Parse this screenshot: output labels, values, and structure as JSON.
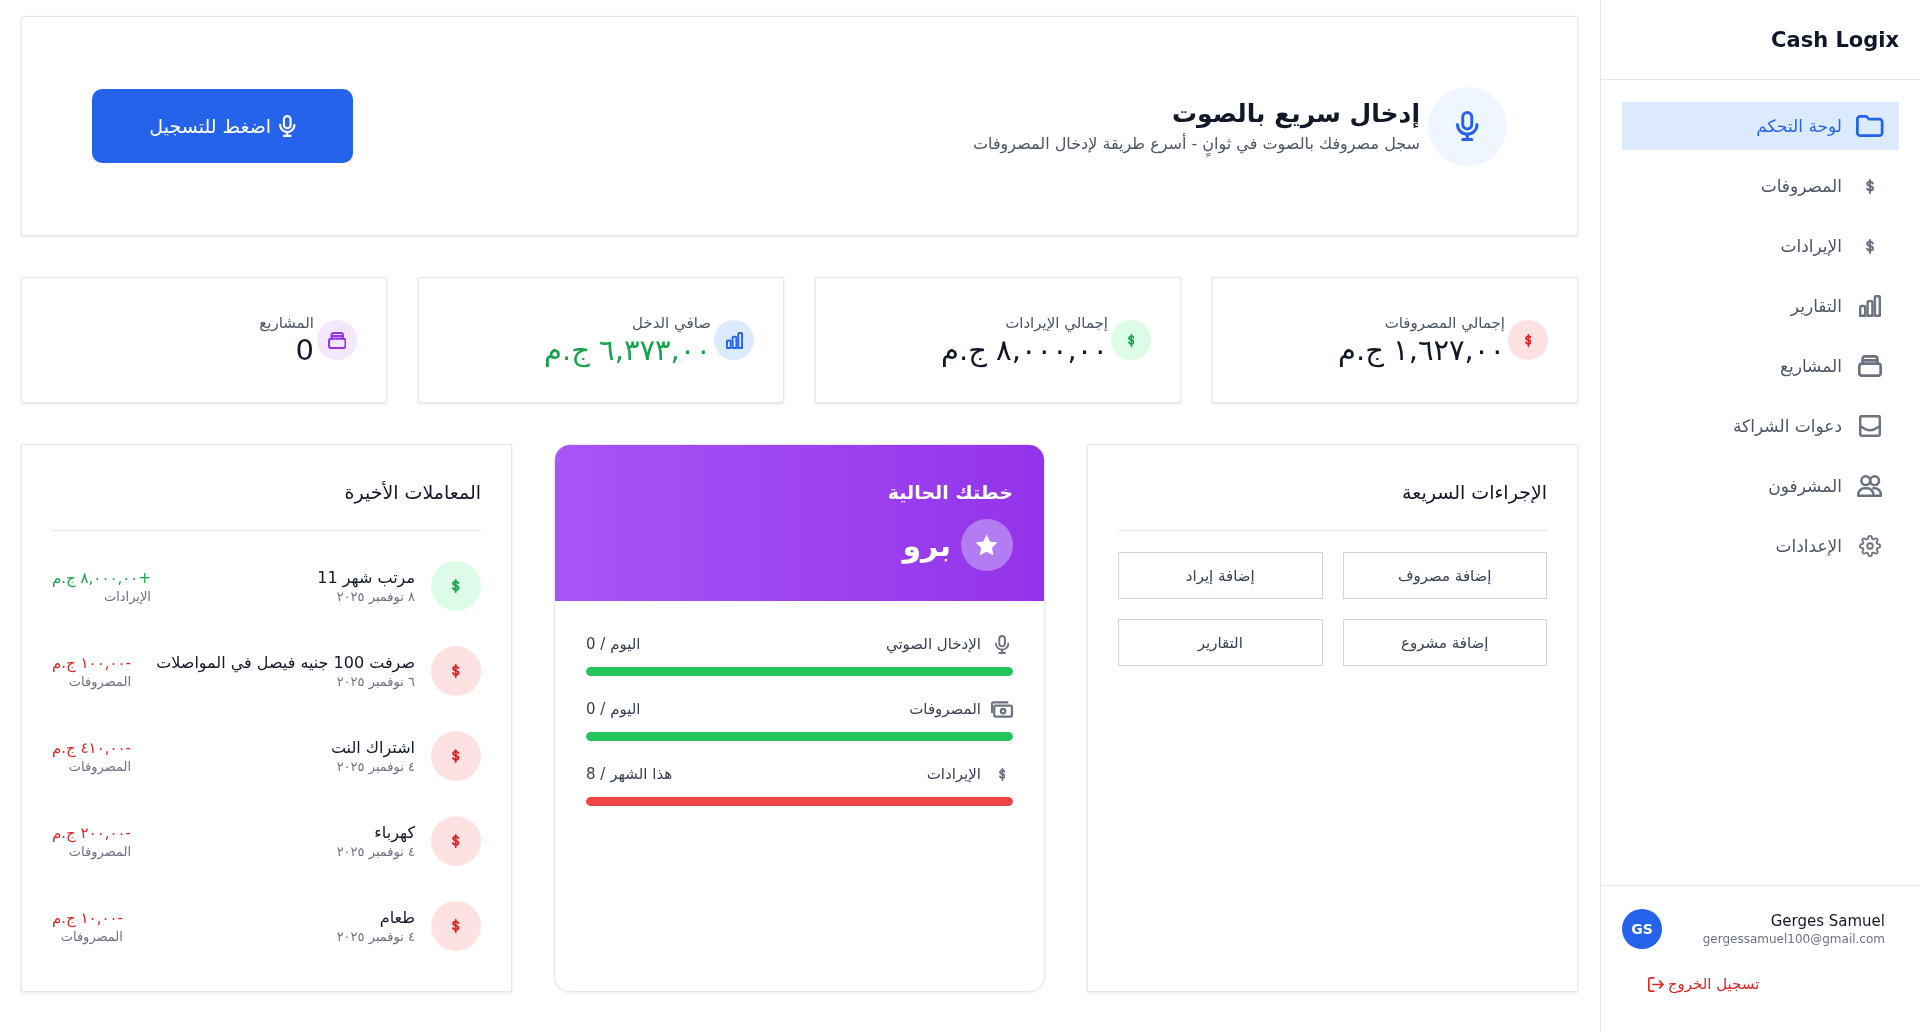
{
  "sidebar": {
    "brand": "Cash Logix",
    "items": [
      {
        "label": "لوحة التحكم",
        "selected": true
      },
      {
        "label": "المصروفات",
        "selected": false
      },
      {
        "label": "الإيرادات",
        "selected": false
      },
      {
        "label": "التقارير",
        "selected": false
      },
      {
        "label": "المشاريع",
        "selected": false
      },
      {
        "label": "دعوات الشراكة",
        "selected": false
      },
      {
        "label": "المشرفون",
        "selected": false
      },
      {
        "label": "الإعدادات",
        "selected": false
      }
    ],
    "user": {
      "initials": "GS",
      "name": "Gerges Samuel",
      "email": "gergessamuel100@gmail.com"
    },
    "logout": "تسجيل الخروج"
  },
  "voice_entry": {
    "title": "إدخال سريع بالصوت",
    "subtitle": "سجل مصروفك بالصوت في ثوانٍ - أسرع طريقة لإدخال المصروفات",
    "button": "اضغط للتسجيل"
  },
  "stats": [
    {
      "label": "إجمالي المصروفات",
      "value": "١,٦٢٧,٠٠ ج.م",
      "positive": false
    },
    {
      "label": "إجمالي الإيرادات",
      "value": "٨,٠٠٠,٠٠ ج.م",
      "positive": false
    },
    {
      "label": "صافي الدخل",
      "value": "٦,٣٧٣,٠٠ ج.م",
      "positive": true
    },
    {
      "label": "المشاريع",
      "value": "0",
      "positive": false
    }
  ],
  "quick_actions": {
    "title": "الإجراءات السريعة",
    "buttons": [
      "إضافة مصروف",
      "إضافة إيراد",
      "إضافة مشروع",
      "التقارير"
    ]
  },
  "plan": {
    "title": "خطتك الحالية",
    "name": "برو",
    "limits": [
      {
        "label": "الإدخال الصوتي",
        "usage": "0 / اليوم",
        "level": 1,
        "color": "#22c55e"
      },
      {
        "label": "المصروفات",
        "usage": "0 / اليوم",
        "level": 1,
        "color": "#22c55e"
      },
      {
        "label": "الإيرادات",
        "usage": "8 / هذا الشهر",
        "level": 1,
        "color": "#ef4444"
      }
    ]
  },
  "transactions": {
    "title": "المعاملات الأخيرة",
    "items": [
      {
        "name": "مرتب شهر 11",
        "date": "٨ نوفمبر ٢٠٢٥",
        "amount": "+٨,٠٠٠,٠٠ ج.م",
        "category": "الإيرادات",
        "kind": "income"
      },
      {
        "name": "صرفت 100 جنيه فيصل في المواصلات",
        "date": "٦ نوفمبر ٢٠٢٥",
        "amount": "-١٠٠,٠٠ ج.م",
        "category": "المصروفات",
        "kind": "expense"
      },
      {
        "name": "اشتراك النت",
        "date": "٤ نوفمبر ٢٠٢٥",
        "amount": "-٤١٠,٠٠ ج.م",
        "category": "المصروفات",
        "kind": "expense"
      },
      {
        "name": "كهرباء",
        "date": "٤ نوفمبر ٢٠٢٥",
        "amount": "-٢٠٠,٠٠ ج.م",
        "category": "المصروفات",
        "kind": "expense"
      },
      {
        "name": "طعام",
        "date": "٤ نوفمبر ٢٠٢٥",
        "amount": "-١٠,٠٠ ج.م",
        "category": "المصروفات",
        "kind": "expense"
      }
    ]
  }
}
